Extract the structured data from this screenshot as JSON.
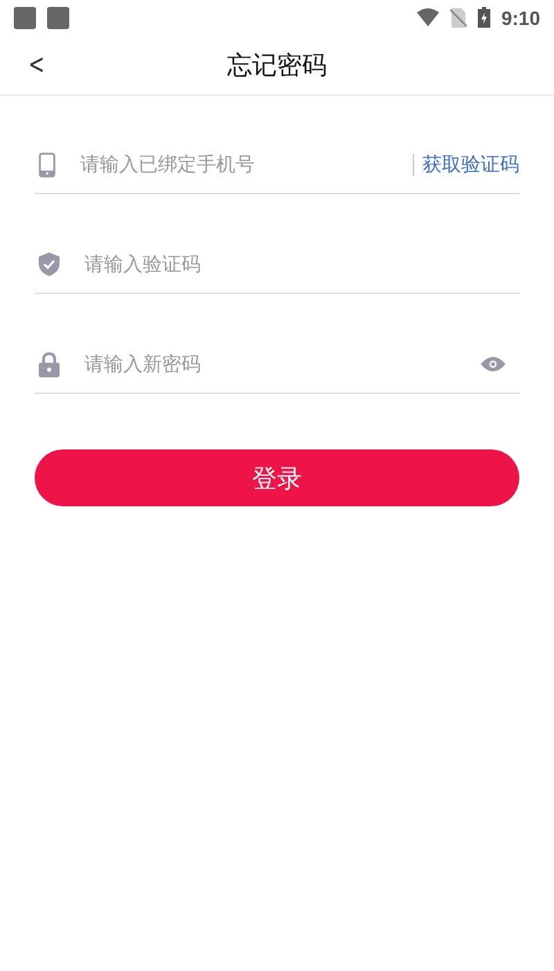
{
  "status_bar": {
    "time": "9:10"
  },
  "header": {
    "back": "<",
    "title": "忘记密码"
  },
  "fields": [
    {
      "kind": "phone",
      "placeholder": "请输入已绑定手机号",
      "action": "获取验证码"
    },
    {
      "kind": "code",
      "placeholder": "请输入验证码"
    },
    {
      "kind": "password",
      "placeholder": "请输入新密码"
    }
  ],
  "submit": "登录"
}
